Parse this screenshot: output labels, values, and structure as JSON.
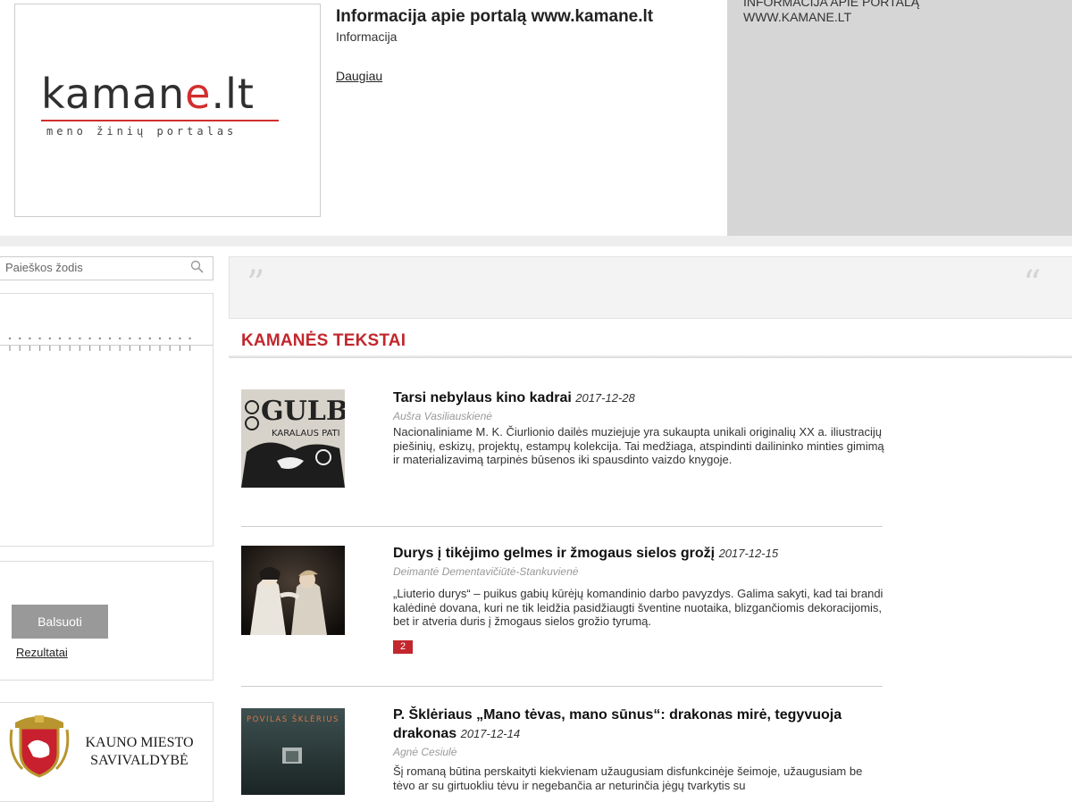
{
  "header": {
    "logo_alt": "kamane.lt",
    "logo_main": "kaman",
    "logo_accent": "e",
    "logo_suffix": ".lt",
    "logo_tagline": "meno žinių portalas",
    "info_title": "Informacija apie portalą www.kamane.lt",
    "info_subtitle": "Informacija",
    "info_more": "Daugiau",
    "right_panel_text": "INFORMACIJA APIE PORTALĄ WWW.KAMANE.LT"
  },
  "sidebar": {
    "search_placeholder": "Paieškos žodis",
    "vote_button": "Balsuoti",
    "results_link": "Rezultatai",
    "sponsor_name": "KAUNO MIESTO SAVIVALDYBĖ"
  },
  "quote": {
    "open_mark": "”",
    "close_mark": "“"
  },
  "section": {
    "title": "KAMANĖS TEKSTAI"
  },
  "articles": [
    {
      "title": "Tarsi nebylaus kino kadrai",
      "date": "2017-12-28",
      "author": "Aušra Vasiliauskienė",
      "text": "Nacionaliniame M. K. Čiurlionio dailės muziejuje yra sukaupta unikali originalių XX a. iliustracijų piešinių, eskizų, projektų, estampų kolekcija. Tai medžiaga, atspindinti dailininko minties gimimą ir materializavimą tarpinės būsenos iki spausdinto vaizdo knygoje.",
      "thumb_text": "GULBĖ",
      "thumb_sub": "KARALAUS PATI"
    },
    {
      "title": "Durys į tikėjimo gelmes ir žmogaus sielos grožį",
      "date": "2017-12-15",
      "author": "Deimantė Dementavičiūtė-Stankuvienė",
      "text": "„Liuterio durys“ – puikus gabių kūrėjų komandinio darbo pavyzdys. Galima sakyti, kad tai brandi kalėdinė dovana, kuri ne tik leidžia pasidžiaugti šventine nuotaika, blizgančiomis dekoracijomis, bet ir atveria duris į žmogaus sielos grožio tyrumą.",
      "comments": "2"
    },
    {
      "title": "P. Šklėriaus „Mano tėvas, mano sūnus“: drakonas mirė, tegyvuoja drakonas",
      "date": "2017-12-14",
      "author": "Agnė Cesiulė",
      "text": "Šį romaną būtina perskaityti kiekvienam užaugusiam disfunkcinėje šeimoje, užaugusiam be tėvo ar su girtuokliu tėvu ir negebančia ar neturinčia jėgų tvarkytis su",
      "thumb_text": "POVILAS ŠKLĖRIUS"
    }
  ],
  "colors": {
    "accent_red": "#c1272d",
    "gray_panel": "#d6d6d6",
    "button_gray": "#999999"
  }
}
